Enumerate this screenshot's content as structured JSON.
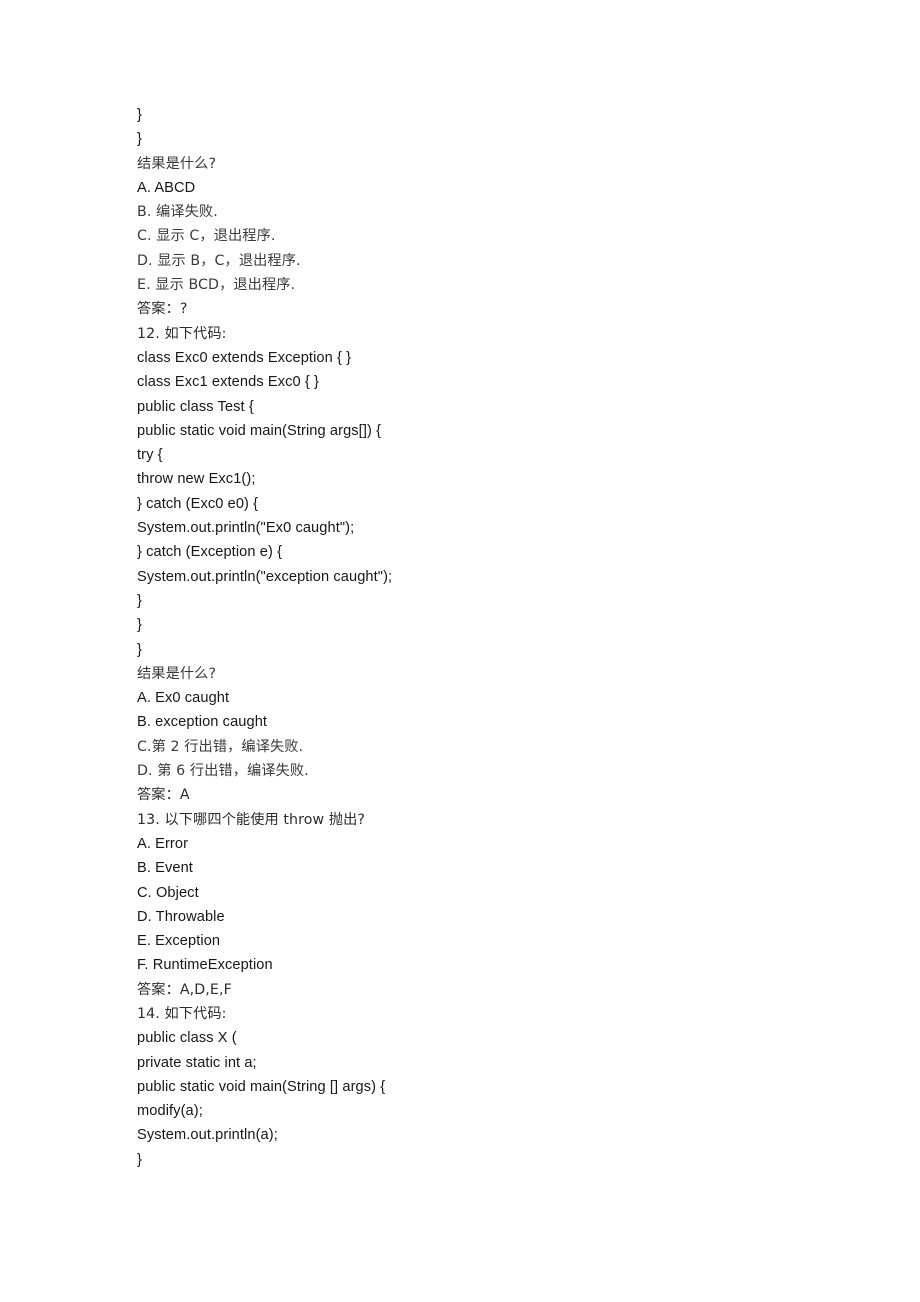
{
  "document": {
    "type": "exam-question-sheet",
    "language": "zh-CN",
    "page_background": "#ffffff",
    "text_color": "#1c1c1c",
    "lines": [
      {
        "id": "l01",
        "text": "}",
        "style": "code"
      },
      {
        "id": "l02",
        "text": "}",
        "style": "code"
      },
      {
        "id": "l03",
        "text": "结果是什么?",
        "style": "cjk"
      },
      {
        "id": "l04",
        "text": "A. ABCD",
        "style": "latin"
      },
      {
        "id": "l05",
        "text": "B. 编译失败.",
        "style": "cjk"
      },
      {
        "id": "l06",
        "text": "C. 显示 C，退出程序.",
        "style": "cjk"
      },
      {
        "id": "l07",
        "text": "D. 显示 B，C，退出程序.",
        "style": "cjk"
      },
      {
        "id": "l08",
        "text": "E. 显示 BCD，退出程序.",
        "style": "cjk"
      },
      {
        "id": "l09",
        "text": "答案：?",
        "style": "cjk-strong"
      },
      {
        "id": "l10",
        "text": "12. 如下代码:",
        "style": "cjk-strong"
      },
      {
        "id": "l11",
        "text": "class Exc0 extends Exception { }",
        "style": "code"
      },
      {
        "id": "l12",
        "text": "class Exc1 extends Exc0 { }",
        "style": "code"
      },
      {
        "id": "l13",
        "text": "public class Test {",
        "style": "code"
      },
      {
        "id": "l14",
        "text": "public static void main(String args[]) {",
        "style": "code"
      },
      {
        "id": "l15",
        "text": "try {",
        "style": "code"
      },
      {
        "id": "l16",
        "text": "throw new Exc1();",
        "style": "code"
      },
      {
        "id": "l17",
        "text": "} catch (Exc0 e0) {",
        "style": "code"
      },
      {
        "id": "l18",
        "text": "System.out.println(\"Ex0 caught\");",
        "style": "code"
      },
      {
        "id": "l19",
        "text": "} catch (Exception e) {",
        "style": "code"
      },
      {
        "id": "l20",
        "text": "System.out.println(\"exception caught\");",
        "style": "code"
      },
      {
        "id": "l21",
        "text": "}",
        "style": "code"
      },
      {
        "id": "l22",
        "text": "}",
        "style": "code"
      },
      {
        "id": "l23",
        "text": "}",
        "style": "code"
      },
      {
        "id": "l24",
        "text": "结果是什么?",
        "style": "cjk"
      },
      {
        "id": "l25",
        "text": "A. Ex0 caught",
        "style": "latin"
      },
      {
        "id": "l26",
        "text": "B. exception caught",
        "style": "latin"
      },
      {
        "id": "l27",
        "text": "C.第 2 行出错，编译失败.",
        "style": "cjk"
      },
      {
        "id": "l28",
        "text": "D. 第 6 行出错，编译失败.",
        "style": "cjk"
      },
      {
        "id": "l29",
        "text": "答案：A",
        "style": "cjk-strong"
      },
      {
        "id": "l30",
        "text": "13. 以下哪四个能使用 throw 抛出?",
        "style": "cjk-strong"
      },
      {
        "id": "l31",
        "text": "A. Error",
        "style": "latin"
      },
      {
        "id": "l32",
        "text": "B. Event",
        "style": "latin"
      },
      {
        "id": "l33",
        "text": "C. Object",
        "style": "latin"
      },
      {
        "id": "l34",
        "text": "D. Throwable",
        "style": "latin"
      },
      {
        "id": "l35",
        "text": "E. Exception",
        "style": "latin"
      },
      {
        "id": "l36",
        "text": "F. RuntimeException",
        "style": "latin"
      },
      {
        "id": "l37",
        "text": "答案：A,D,E,F",
        "style": "cjk-strong"
      },
      {
        "id": "l38",
        "text": "14. 如下代码:",
        "style": "cjk-strong"
      },
      {
        "id": "l39",
        "text": "public class X (",
        "style": "code"
      },
      {
        "id": "l40",
        "text": "private static int a;",
        "style": "code"
      },
      {
        "id": "l41",
        "text": "public static void main(String [] args) {",
        "style": "code"
      },
      {
        "id": "l42",
        "text": "modify(a);",
        "style": "code"
      },
      {
        "id": "l43",
        "text": "System.out.println(a);",
        "style": "code"
      },
      {
        "id": "l44",
        "text": "}",
        "style": "code"
      }
    ]
  }
}
